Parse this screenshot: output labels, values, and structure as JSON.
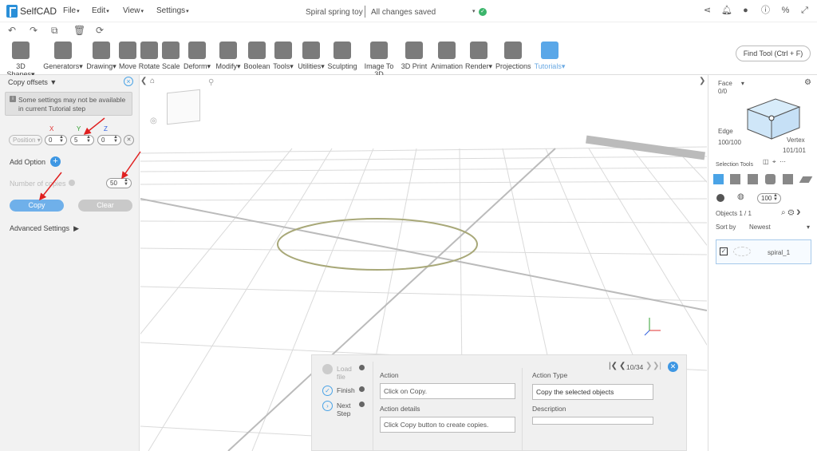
{
  "app": {
    "name": "SelfCAD",
    "doc_title": "Spiral spring toy",
    "save_status": "All changes saved"
  },
  "menus": [
    "File",
    "Edit",
    "View",
    "Settings"
  ],
  "toolbar": {
    "tools": [
      "3D Shapes",
      "Generators",
      "Drawing",
      "Move",
      "Rotate",
      "Scale",
      "Deform",
      "Modify",
      "Boolean",
      "Tools",
      "Utilities",
      "Sculpting",
      "Image To 3D",
      "3D Print",
      "Animation",
      "Render",
      "Projections",
      "Tutorials"
    ],
    "find_tool": "Find Tool (Ctrl + F)"
  },
  "left_panel": {
    "title": "Copy offsets",
    "note": "Some settings may not be available in current Tutorial step",
    "axes": {
      "x_label": "X",
      "y_label": "Y",
      "z_label": "Z"
    },
    "position_label": "Position",
    "x_value": "0",
    "y_value": "5",
    "z_value": "0",
    "add_option": "Add Option",
    "num_copies_label": "Number of copies",
    "num_copies_value": "50",
    "copy_button": "Copy",
    "clear_button": "Clear",
    "advanced": "Advanced Settings"
  },
  "right_panel": {
    "face_label": "Face",
    "face_count": "0/0",
    "edge_label": "Edge",
    "edge_count": "100/100",
    "vertex_label": "Vertex",
    "vertex_count": "101/101",
    "selection_tools": "Selection Tools",
    "brush_size": "100",
    "objects_label": "Objects 1 / 1",
    "sort_label": "Sort by",
    "sort_value": "Newest",
    "object_name": "spiral_1"
  },
  "tutorial": {
    "steps": [
      {
        "label": "Load file"
      },
      {
        "label": "Finish"
      },
      {
        "label": "Next Step"
      }
    ],
    "pager": "10/34",
    "action_label": "Action",
    "action_value": "Click on Copy.",
    "action_details_label": "Action details",
    "action_details_value": "Click Copy button to create copies.",
    "action_type_label": "Action Type",
    "action_type_value": "Copy the selected objects",
    "description_label": "Description",
    "description_value": ""
  },
  "colors": {
    "accent": "#3e97e3",
    "arrow": "#e02020",
    "spiral": "#a8a878"
  }
}
